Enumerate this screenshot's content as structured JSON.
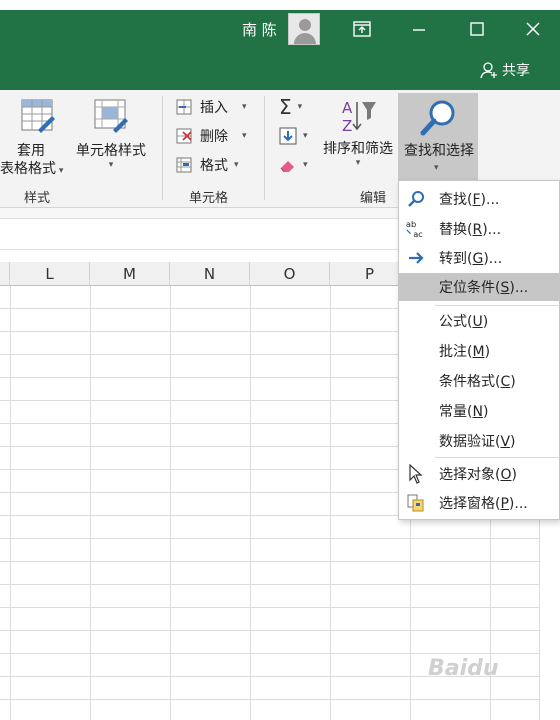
{
  "titlebar": {
    "user_name": "南 陈",
    "share_label": "共享"
  },
  "ribbon": {
    "styles_group": {
      "table_format_top": "套用",
      "table_format_bottom": "表格格式",
      "cell_style_label": "单元格样式",
      "label": "样式"
    },
    "cells_group": {
      "insert_label": "插入",
      "delete_label": "删除",
      "format_label": "格式",
      "label": "单元格"
    },
    "edit_group": {
      "sort_filter_label": "排序和筛选",
      "find_select_label": "查找和选择",
      "label": "编辑"
    }
  },
  "columns": [
    "L",
    "M",
    "N",
    "O",
    "P"
  ],
  "menu": {
    "items": [
      {
        "pre": "查找(",
        "key": "F",
        "post": ")...",
        "icon": "magnifier-icon"
      },
      {
        "pre": "替换(",
        "key": "R",
        "post": ")...",
        "icon": "replace-abac-icon"
      },
      {
        "pre": "转到(",
        "key": "G",
        "post": ")...",
        "icon": "arrow-right-icon"
      },
      {
        "pre": "定位条件(",
        "key": "S",
        "post": ")...",
        "icon": ""
      },
      {
        "pre": "公式(",
        "key": "U",
        "post": ")",
        "icon": ""
      },
      {
        "pre": "批注(",
        "key": "M",
        "post": ")",
        "icon": ""
      },
      {
        "pre": "条件格式(",
        "key": "C",
        "post": ")",
        "icon": ""
      },
      {
        "pre": "常量(",
        "key": "N",
        "post": ")",
        "icon": ""
      },
      {
        "pre": "数据验证(",
        "key": "V",
        "post": ")",
        "icon": ""
      },
      {
        "pre": "选择对象(",
        "key": "O",
        "post": ")",
        "icon": "cursor-arrow-icon"
      },
      {
        "pre": "选择窗格(",
        "key": "P",
        "post": ")...",
        "icon": "selection-pane-icon"
      }
    ]
  },
  "colors": {
    "title_green": "#217346",
    "ribbon_bg": "#f3f3f3",
    "highlight": "#c6c6c6"
  },
  "watermark": "Baidu"
}
